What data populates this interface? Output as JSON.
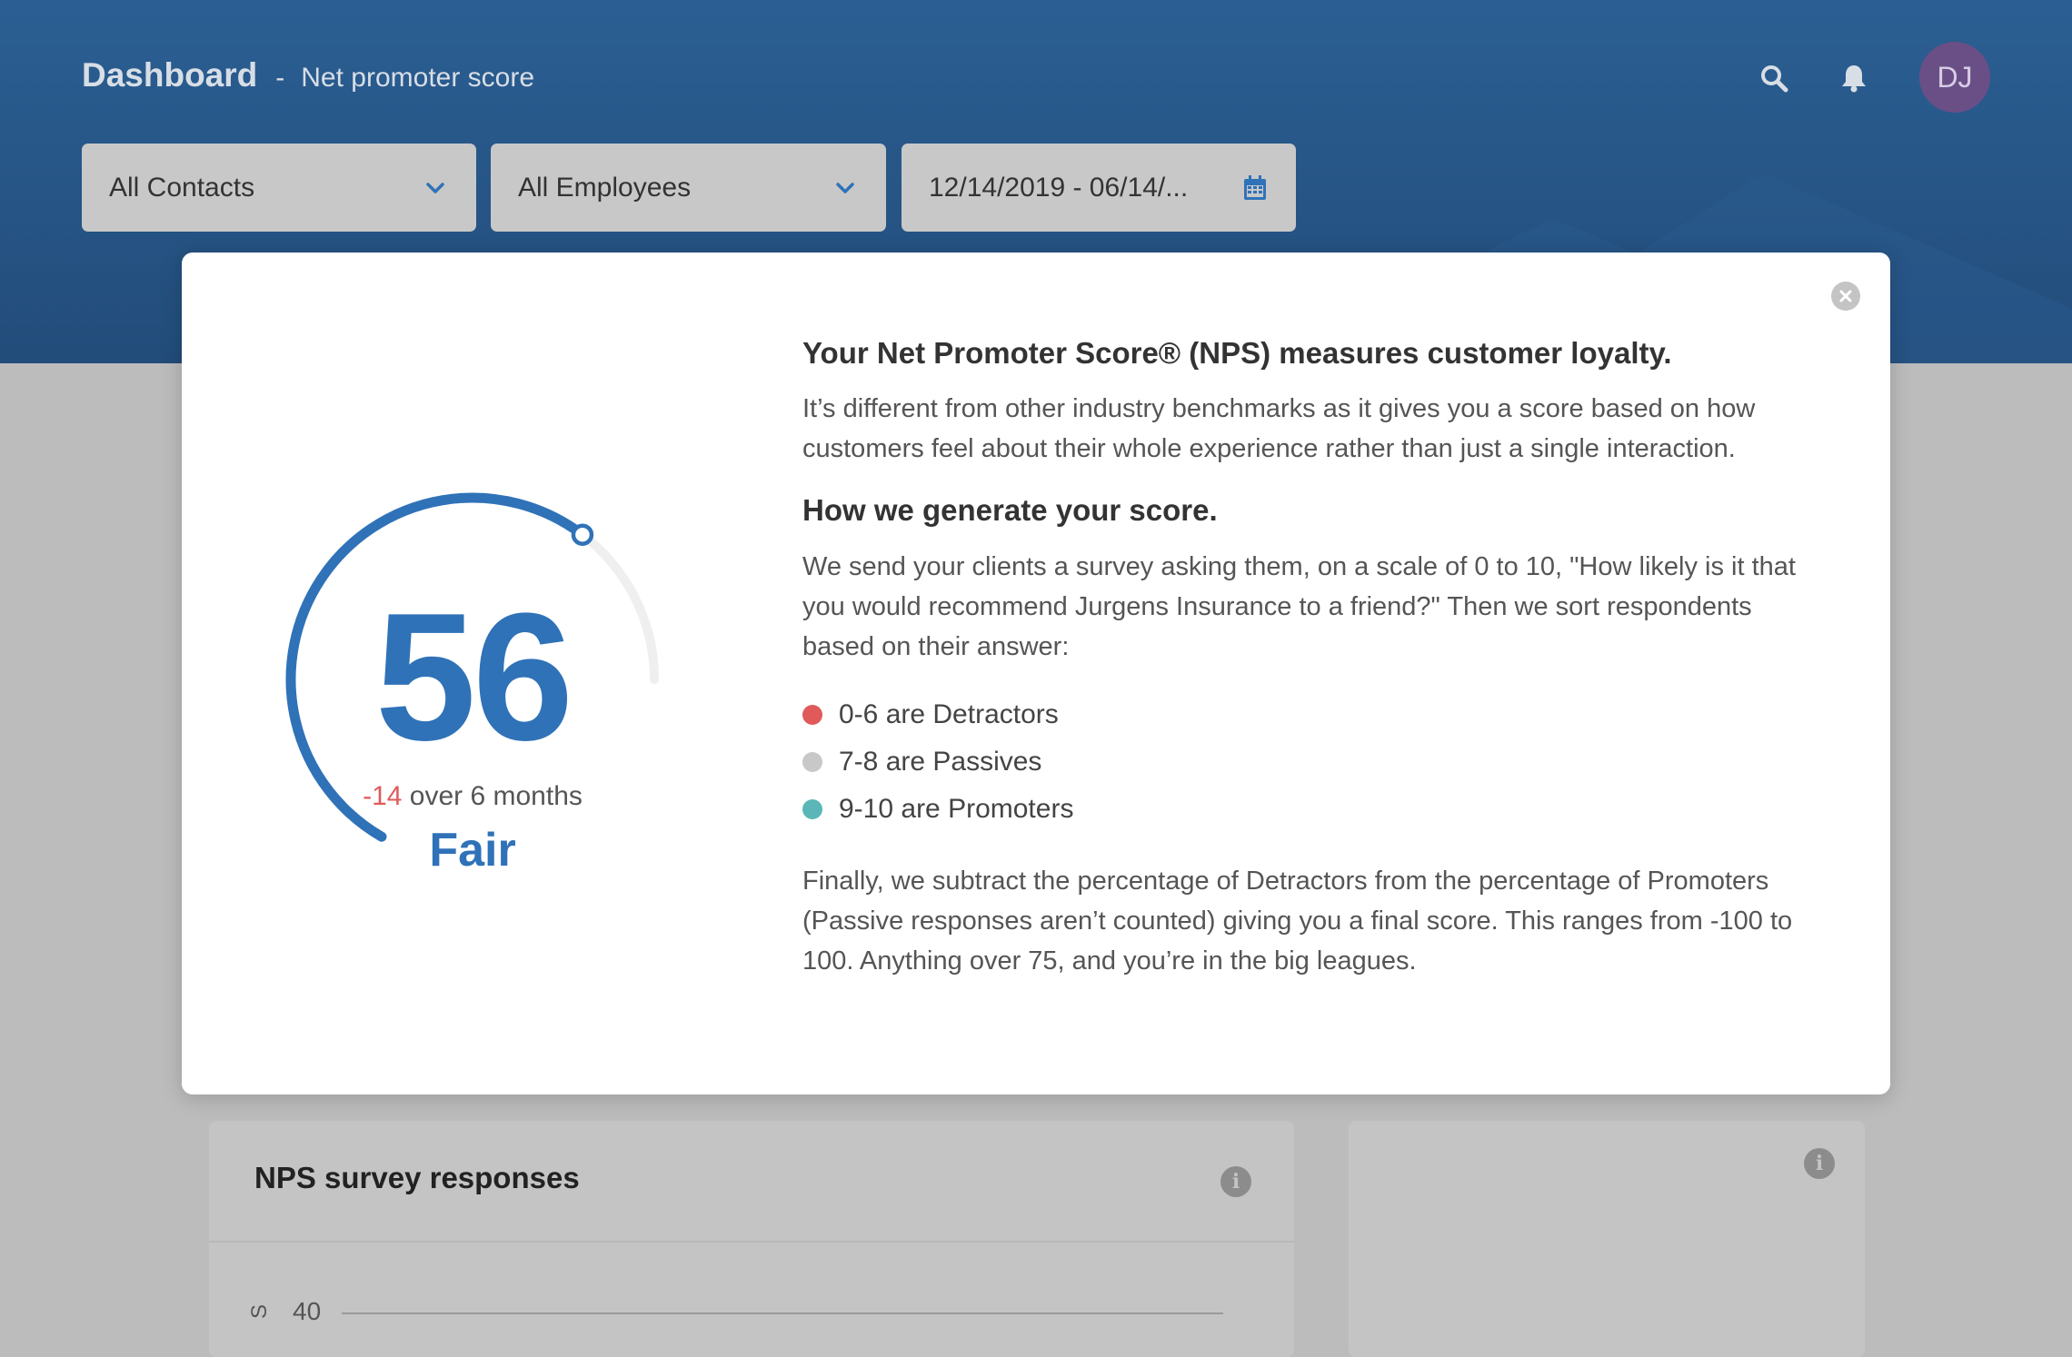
{
  "header": {
    "title": "Dashboard",
    "separator": "-",
    "subtitle": "Net promoter score",
    "avatar_initials": "DJ"
  },
  "filters": {
    "contacts": "All Contacts",
    "employees": "All Employees",
    "date_range": "12/14/2019 - 06/14/..."
  },
  "modal": {
    "score": "56",
    "change_value": "-14",
    "change_suffix": " over 6 months",
    "rating": "Fair",
    "heading1": "Your Net Promoter Score® (NPS) measures customer loyalty.",
    "paragraph1": "It’s different from other industry benchmarks as it gives you a score based on how customers feel about their whole experience rather than just a single interaction.",
    "heading2": "How we generate your score.",
    "paragraph2": "We send your clients a survey asking them, on a scale of 0 to 10, \"How likely is it that you would recommend Jurgens Insurance to a friend?\" Then we sort respondents based on their answer:",
    "legend": [
      {
        "label": "0-6 are Detractors",
        "color": "#e05a5a"
      },
      {
        "label": "7-8 are Passives",
        "color": "#c8c8c8"
      },
      {
        "label": "9-10 are Promoters",
        "color": "#5bb7b7"
      }
    ],
    "paragraph3": "Finally, we subtract the percentage of Detractors from the percentage of Promoters (Passive responses aren’t counted) giving you a final score. This ranges from -100 to 100. Anything over 75, and you’re in the big leagues.",
    "gauge_value": 56,
    "gauge_min": -100,
    "gauge_max": 100,
    "accent_color": "#2f72b8"
  },
  "cards": {
    "survey_title": "NPS survey responses",
    "axis_tick": "40",
    "axis_label_fragment": "S"
  },
  "icons": {
    "search": "search-icon",
    "notifications": "bell-icon",
    "dropdown": "chevron-down-icon",
    "calendar": "calendar-icon",
    "close": "close-icon",
    "info": "info-icon"
  }
}
